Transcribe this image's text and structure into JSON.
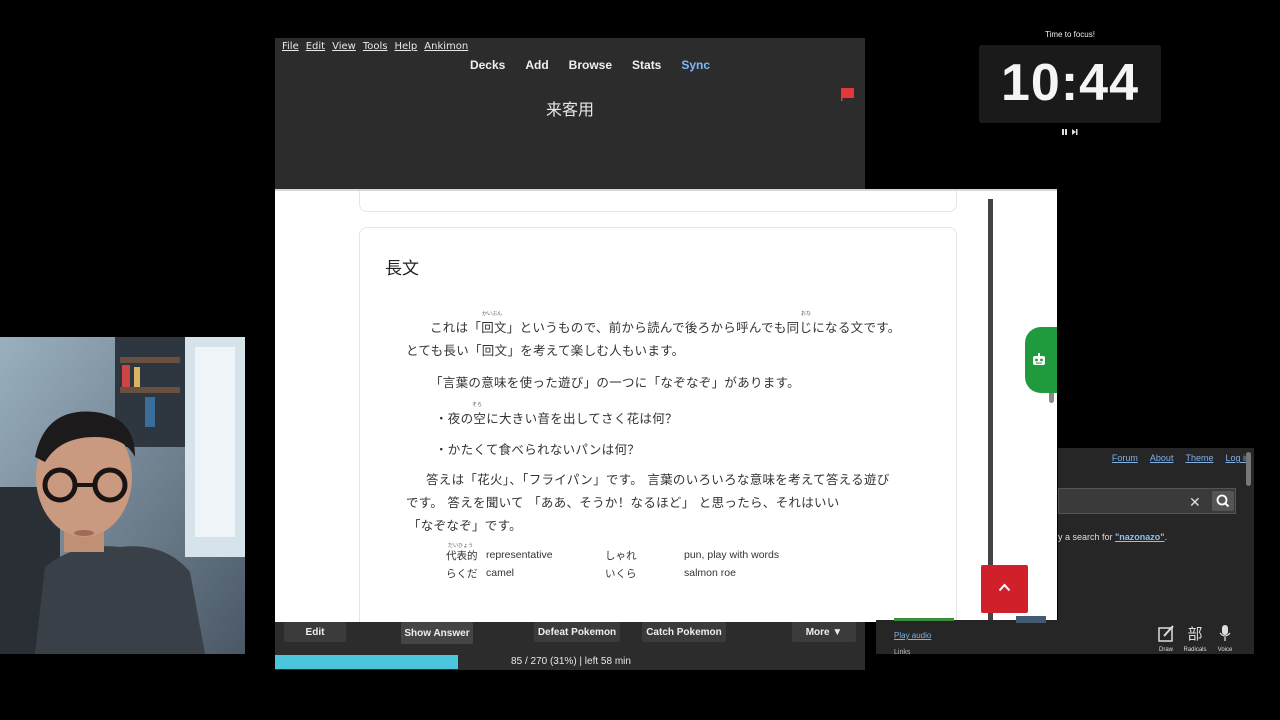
{
  "menu": [
    "File",
    "Edit",
    "View",
    "Tools",
    "Help",
    "Ankimon"
  ],
  "toplinks": {
    "decks": "Decks",
    "add": "Add",
    "browse": "Browse",
    "stats": "Stats",
    "sync": "Sync"
  },
  "deck_title": "来客用",
  "card": {
    "heading": "長文",
    "lines": [
      "これは「回文」というもので、前から読んで後ろから呼んでも同じになる文です。",
      "とても長い「回文」を考えて楽しむ人もいます。",
      "「言葉の意味を使った遊び」の一つに「なぞなぞ」があります。",
      "・夜の空に大きい音を出してさく花は何？",
      "・かたくて食べられないパンは何？",
      "答えは「花火」、「フライパン」です。 言葉のいろいろな意味を考えて答える遊び",
      "です。 答えを聞いて 「ああ、そうか！なるほど」 と思ったら、それはいい",
      "「なぞなぞ」です。"
    ],
    "ruby": {
      "kaibun": "かいぶん",
      "onaji": "おな",
      "sora": "そら",
      "daihyou": "だいひょう"
    },
    "vocab": [
      {
        "jp": "代表的",
        "en": "representative"
      },
      {
        "jp": "らくだ",
        "en": "camel"
      },
      {
        "jp": "しゃれ",
        "en": "pun, play with words"
      },
      {
        "jp": "いくら",
        "en": "salmon roe"
      }
    ]
  },
  "buttons": {
    "edit": "Edit",
    "show_answer": "Show Answer",
    "defeat": "Defeat Pokemon",
    "catch": "Catch Pokemon",
    "more": "More ▼"
  },
  "progress": {
    "text": "85 / 270 (31%) | left 58 min",
    "fraction": 0.31
  },
  "timer": {
    "label": "Time to focus!",
    "value": "10:44"
  },
  "jisho": {
    "nav": [
      "Forum",
      "About",
      "Theme",
      "Log in"
    ],
    "clear": "✕",
    "result_prefix": "y a search for ",
    "result_term": "\"nazonazo\"",
    "result_suffix": ".",
    "play_audio": "Play audio",
    "links": "Links",
    "tools": {
      "draw": "Draw",
      "radicals": "Radicals",
      "radicals_glyph": "部",
      "voice": "Voice"
    }
  },
  "colors": {
    "accent_sync": "#7fb8ff",
    "progress": "#4bc6dc",
    "robot_tab": "#1f9a3d",
    "scroll_button": "#d0202a",
    "flag": "#e2383a"
  }
}
